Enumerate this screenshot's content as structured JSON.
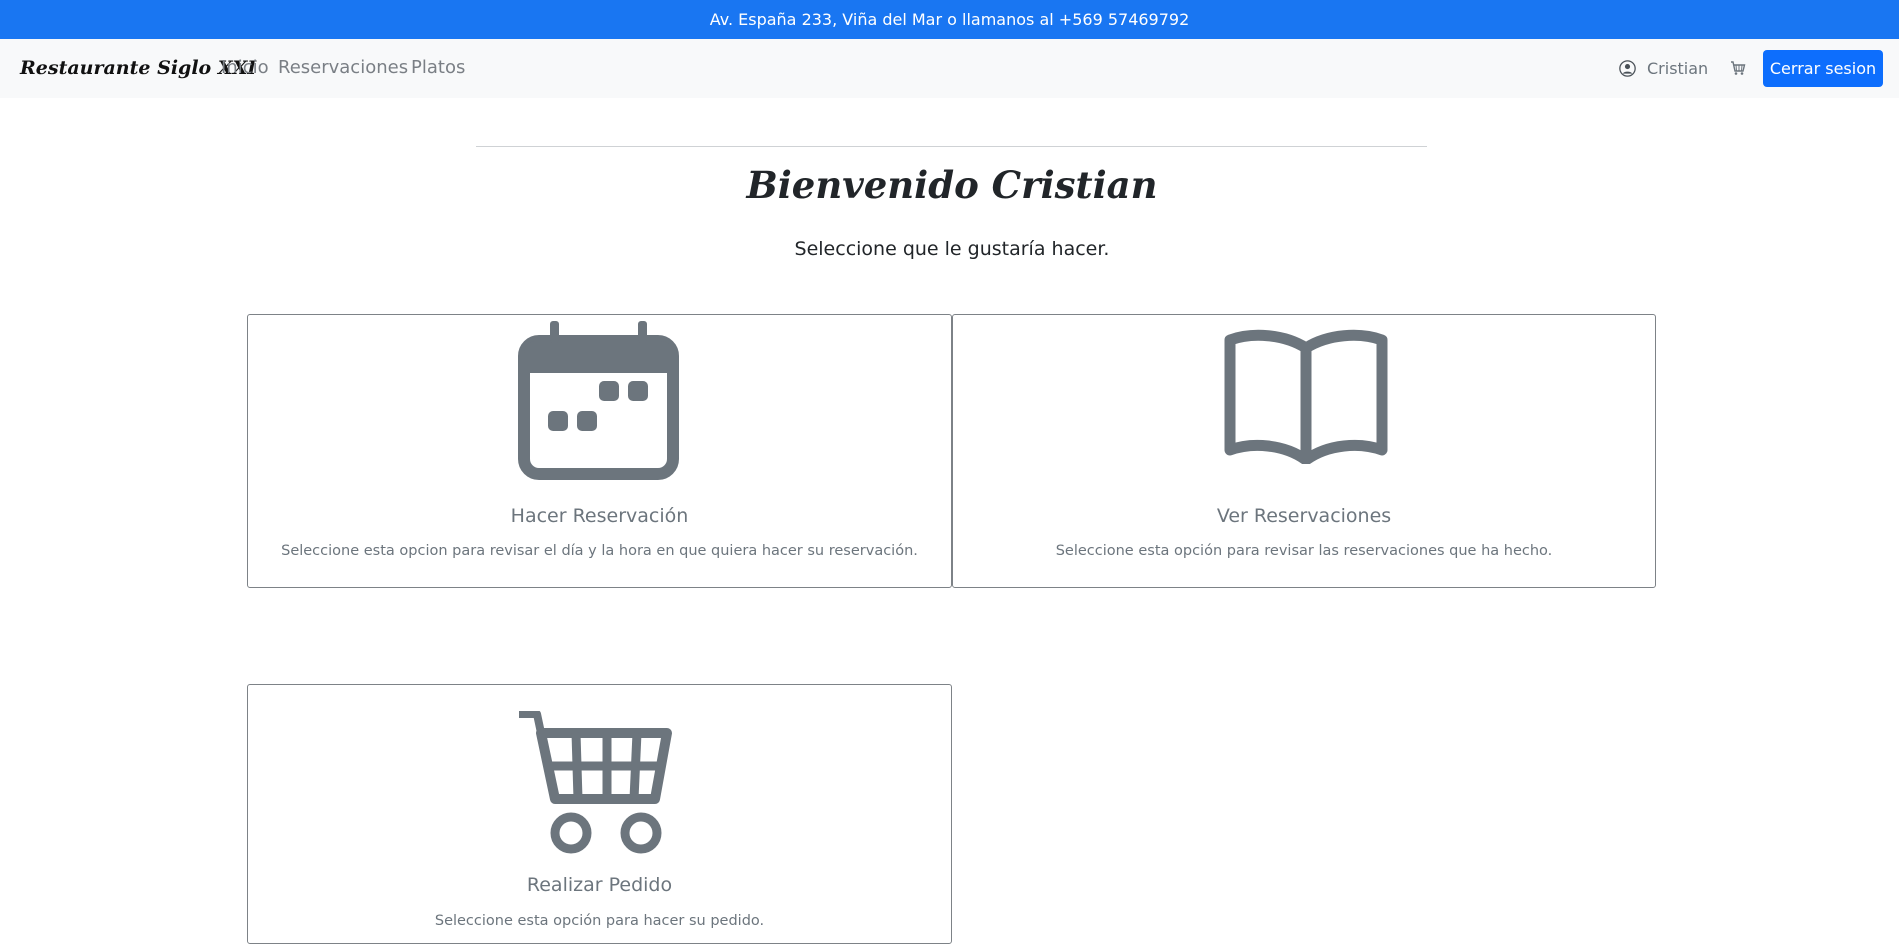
{
  "topbar": {
    "text": "Av. España 233, Viña del Mar o llamanos al +569 57469792"
  },
  "navbar": {
    "brand": "Restaurante Siglo XXI",
    "links": [
      "Inicio",
      "Reservaciones",
      "Platos"
    ],
    "user_name": "Cristian",
    "logout_label": "Cerrar sesion"
  },
  "main": {
    "title": "Bienvenido Cristian",
    "subtitle": "Seleccione que le gustaría hacer.",
    "cards": [
      {
        "icon": "calendar-icon",
        "title": "Hacer Reservación",
        "text": "Seleccione esta opcion para revisar el día y la hora en que quiera hacer su reservación."
      },
      {
        "icon": "open-book-icon",
        "title": "Ver Reservaciones",
        "text": "Seleccione esta opción para revisar las reservaciones que ha hecho."
      },
      {
        "icon": "shopping-cart-icon",
        "title": "Realizar Pedido",
        "text": "Seleccione esta opción para hacer su pedido."
      }
    ]
  },
  "colors": {
    "topbar": "#1976f2",
    "primary": "#0d6efd",
    "icon": "#6c757d",
    "navbar": "#f8f9fa"
  }
}
